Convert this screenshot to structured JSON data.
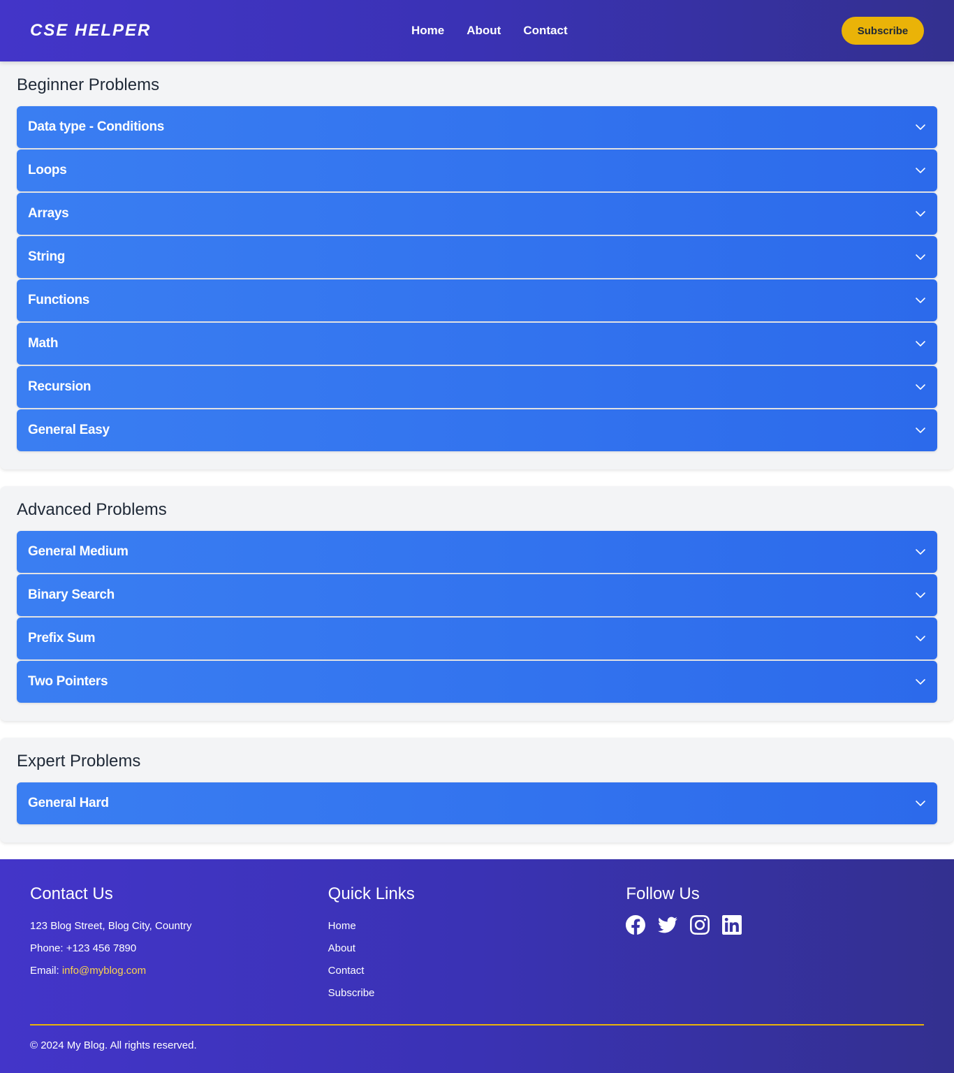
{
  "header": {
    "logo": "CSE HELPER",
    "nav": [
      "Home",
      "About",
      "Contact"
    ],
    "subscribe_label": "Subscribe"
  },
  "sections": [
    {
      "title": "Beginner Problems",
      "items": [
        "Data type - Conditions",
        "Loops",
        "Arrays",
        "String",
        "Functions",
        "Math",
        "Recursion",
        "General Easy"
      ]
    },
    {
      "title": "Advanced Problems",
      "items": [
        "General Medium",
        "Binary Search",
        "Prefix Sum",
        "Two Pointers"
      ]
    },
    {
      "title": "Expert Problems",
      "items": [
        "General Hard"
      ]
    }
  ],
  "footer": {
    "contact": {
      "title": "Contact Us",
      "address": "123 Blog Street, Blog City, Country",
      "phone": "Phone: +123 456 7890",
      "email_label": "Email: ",
      "email": "info@myblog.com"
    },
    "quick_links": {
      "title": "Quick Links",
      "links": [
        "Home",
        "About",
        "Contact",
        "Subscribe"
      ]
    },
    "follow": {
      "title": "Follow Us",
      "icons": [
        "facebook-icon",
        "twitter-icon",
        "instagram-icon",
        "linkedin-icon"
      ]
    },
    "copyright": "© 2024 My Blog. All rights reserved."
  },
  "colors": {
    "header_bg": "#3a32b4",
    "accent": "#eab308",
    "accordion": "#3177ef",
    "section_bg": "#f3f4f6"
  }
}
